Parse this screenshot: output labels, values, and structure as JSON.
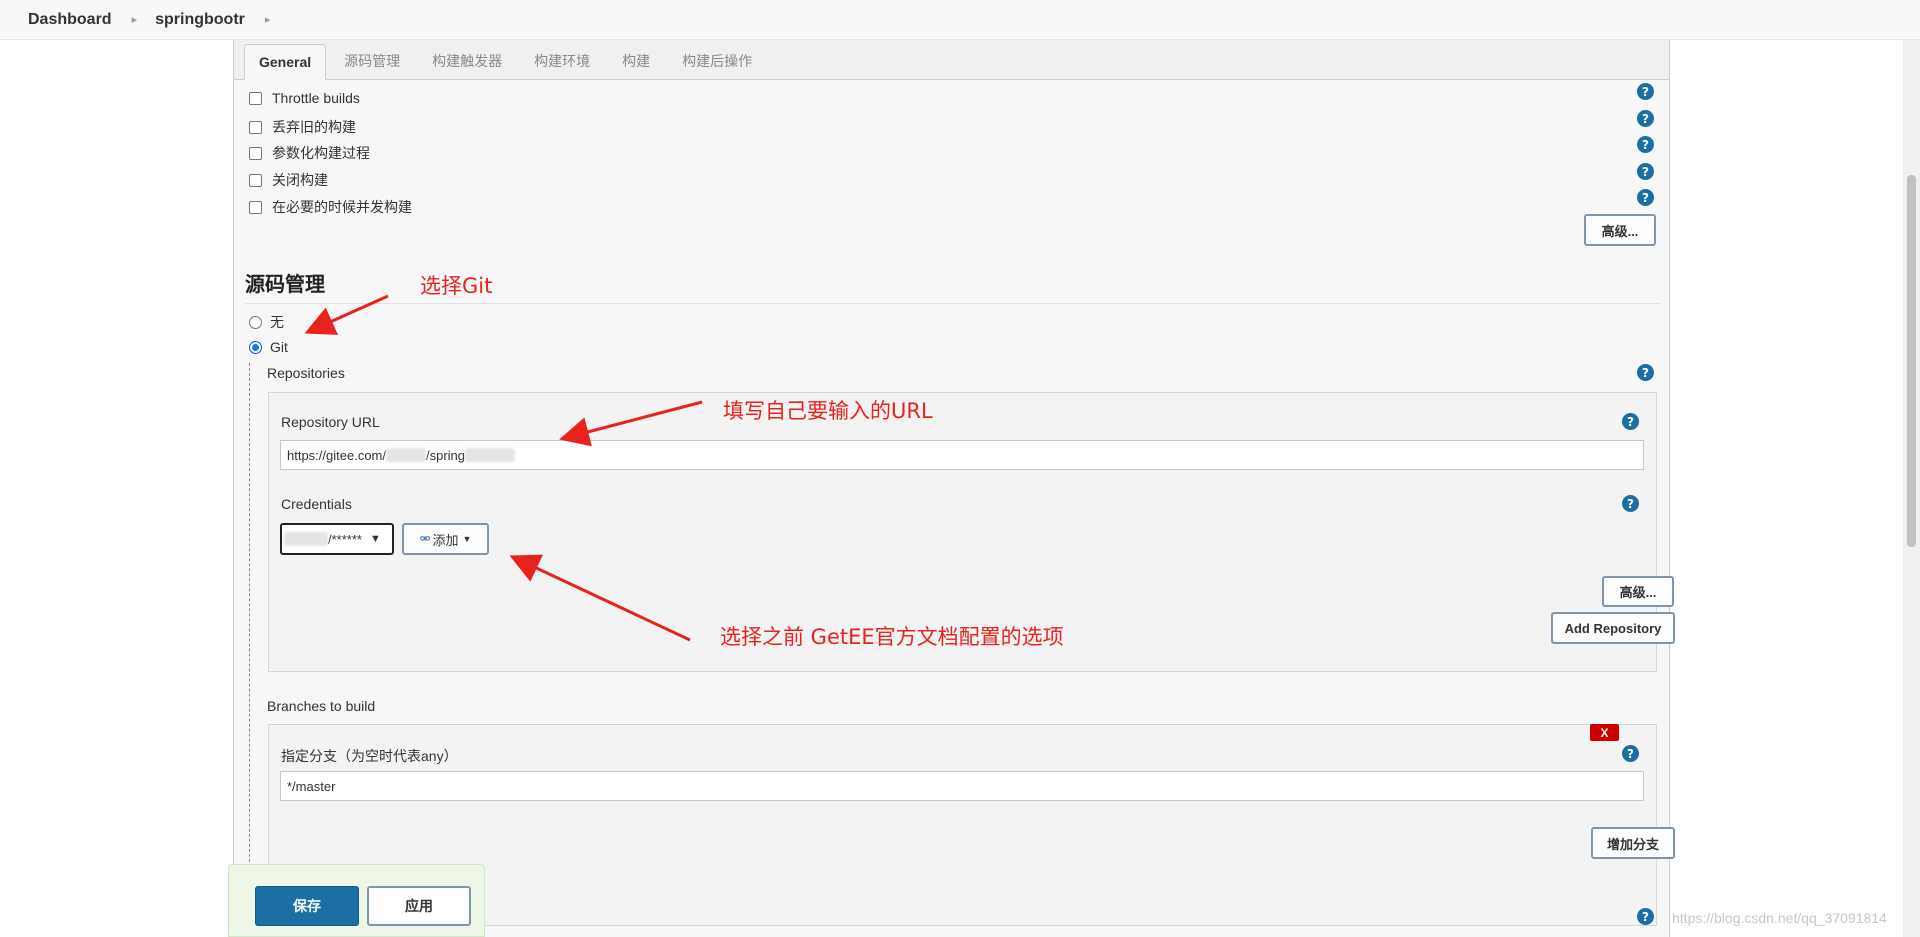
{
  "breadcrumb": [
    "Dashboard",
    "springbootr"
  ],
  "tabs": [
    "General",
    "源码管理",
    "构建触发器",
    "构建环境",
    "构建",
    "构建后操作"
  ],
  "general": {
    "options": [
      "Throttle builds",
      "丢弃旧的构建",
      "参数化构建过程",
      "关闭构建",
      "在必要的时候并发构建"
    ],
    "advanced_label": "高级..."
  },
  "scm": {
    "title": "源码管理",
    "none_label": "无",
    "git_label": "Git",
    "selected": "Git",
    "repositories_label": "Repositories",
    "repo_url_label": "Repository URL",
    "repo_url_parts": [
      "https://gitee.com/",
      "/spring"
    ],
    "credentials_label": "Credentials",
    "credentials_value": "/******",
    "add_label": "添加",
    "advanced_label": "高级...",
    "add_repository_label": "Add Repository",
    "branches_label": "Branches to build",
    "branch_spec_label": "指定分支（为空时代表any）",
    "branch_value": "*/master",
    "delete_label": "X",
    "add_branch_label": "增加分支"
  },
  "help_glyph": "?",
  "footer": {
    "save_label": "保存",
    "apply_label": "应用"
  },
  "annotations": {
    "select_git": "选择Git",
    "fill_url": "填写自己要输入的URL",
    "select_credentials": "选择之前 GetEE官方文档配置的选项"
  },
  "watermark": "https://blog.csdn.net/qq_37091814",
  "colors": {
    "primary": "#1b6fa3",
    "annotation": "#e8231e",
    "delete": "#cc0000"
  }
}
